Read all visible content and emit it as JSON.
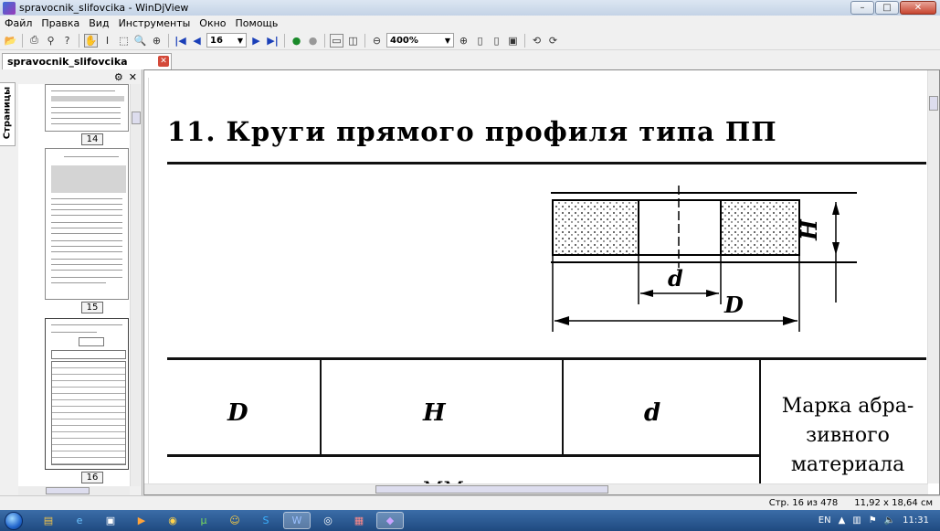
{
  "window": {
    "title": "spravocnik_slifovcika - WinDjView",
    "min": "–",
    "max": "□",
    "close": "✕"
  },
  "menu": [
    "Файл",
    "Правка",
    "Вид",
    "Инструменты",
    "Окно",
    "Помощь"
  ],
  "toolbar": {
    "page_value": "16",
    "zoom_value": "400%"
  },
  "tab": {
    "label": "spravocnik_slifovcika",
    "close": "✕"
  },
  "sidebar": {
    "tab_label": "Страницы",
    "gear": "⚙",
    "close": "✕",
    "thumb_labels": [
      "14",
      "15",
      "16"
    ]
  },
  "page": {
    "heading": "11. Круги прямого профиля типа ПП",
    "diagram_labels": {
      "H": "H",
      "d": "d",
      "D": "D"
    },
    "table_headers": {
      "col1": "D",
      "col2": "H",
      "col3": "d",
      "col4": "Марка абра-\nзивного\nматериала"
    },
    "table_cut": "ММ"
  },
  "status": {
    "page_info": "Стр. 16 из 478",
    "size_info": "11,92 x 18,64 см"
  },
  "tray": {
    "lang": "EN",
    "clock": "11:31"
  }
}
